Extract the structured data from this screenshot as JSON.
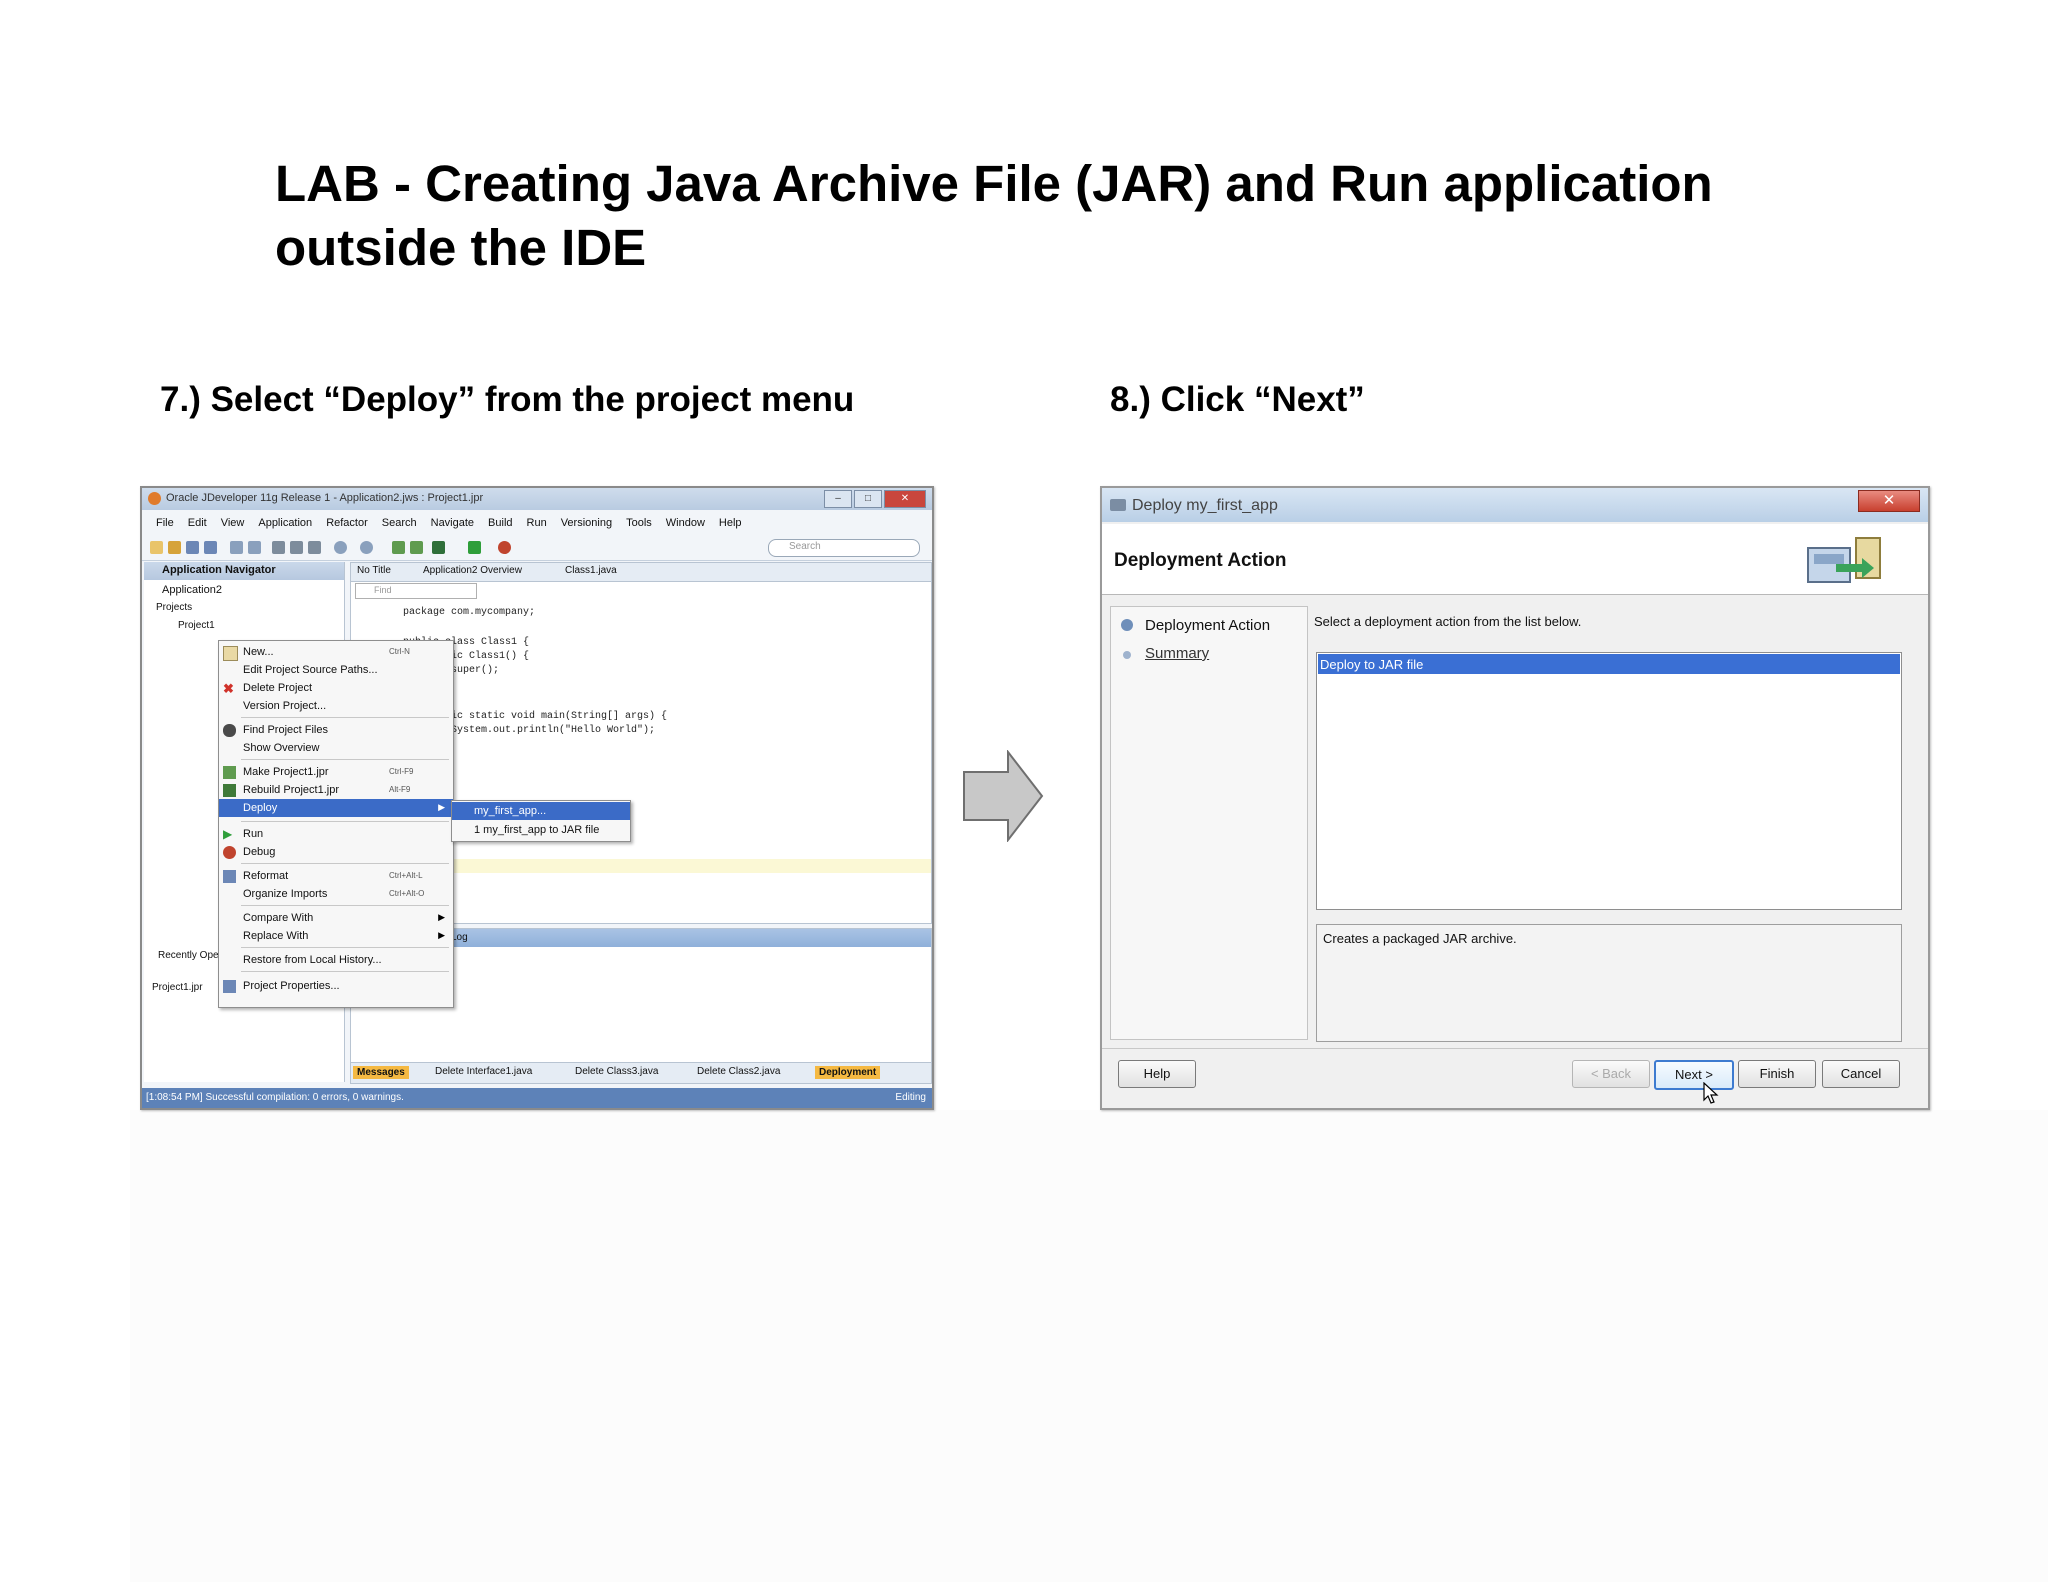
{
  "page": {
    "title": "LAB - Creating Java Archive File (JAR) and Run application outside the IDE",
    "step7": "7.) Select “Deploy” from the project menu",
    "step8": "8.) Click “Next”"
  },
  "ide": {
    "window_title": "Oracle JDeveloper 11g Release 1 - Application2.jws : Project1.jpr",
    "menu": [
      "File",
      "Edit",
      "View",
      "Application",
      "Refactor",
      "Search",
      "Navigate",
      "Build",
      "Run",
      "Versioning",
      "Tools",
      "Window",
      "Help"
    ],
    "search_placeholder": "Search",
    "navigator": {
      "title": "Application Navigator",
      "application": "Application2",
      "projects_label": "Projects",
      "project_node": "Project1",
      "recently_opened": "Recently Opened Files",
      "structure_item": "Project1.jpr"
    },
    "editor_tabs": [
      "No Title",
      "Application2 Overview",
      "Class1.java"
    ],
    "find_placeholder": "Find",
    "code_lines": [
      "package com.mycompany;",
      "",
      "public class Class1 {",
      "    public Class1() {",
      "        super();",
      "    }",
      "",
      "    public static void main(String[] args) {",
      "        System.out.println(\"Hello World\");",
      "    }"
    ],
    "context_menu": [
      {
        "label": "New...",
        "shortcut": "Ctrl-N"
      },
      {
        "label": "Edit Project Source Paths..."
      },
      {
        "label": "Delete Project"
      },
      {
        "label": "Version Project..."
      },
      {
        "label": "Find Project Files"
      },
      {
        "label": "Show Overview"
      },
      {
        "label": "Make Project1.jpr",
        "shortcut": "Ctrl-F9"
      },
      {
        "label": "Rebuild Project1.jpr",
        "shortcut": "Alt-F9"
      },
      {
        "label": "Deploy"
      },
      {
        "label": "Run"
      },
      {
        "label": "Debug"
      },
      {
        "label": "Reformat",
        "shortcut": "Ctrl+Alt-L"
      },
      {
        "label": "Organize Imports",
        "shortcut": "Ctrl+Alt-O"
      },
      {
        "label": "Compare With"
      },
      {
        "label": "Replace With"
      },
      {
        "label": "Restore from Local History..."
      },
      {
        "label": "Project Properties..."
      }
    ],
    "submenu": [
      "my_first_app...",
      "1 my_first_app to JAR file"
    ],
    "log_tab": "Log",
    "bottom_tabs": [
      "Messages",
      "Delete Interface1.java",
      "Delete Class3.java",
      "Delete Class2.java",
      "Deployment"
    ],
    "status": "[1:08:54 PM] Successful compilation: 0 errors, 0 warnings.",
    "status_right": "Editing"
  },
  "dialog": {
    "title": "Deploy my_first_app",
    "header": "Deployment Action",
    "steps": [
      "Deployment Action",
      "Summary"
    ],
    "prompt": "Select a deployment action from the list below.",
    "selected_action": "Deploy to JAR file",
    "description": "Creates a packaged JAR archive.",
    "buttons": {
      "help": "Help",
      "back": "< Back",
      "next": "Next >",
      "finish": "Finish",
      "cancel": "Cancel"
    }
  },
  "colors": {
    "selection": "#3a6fd4",
    "arrow": "#c8c8c8",
    "status_bar": "#5d82b8"
  }
}
